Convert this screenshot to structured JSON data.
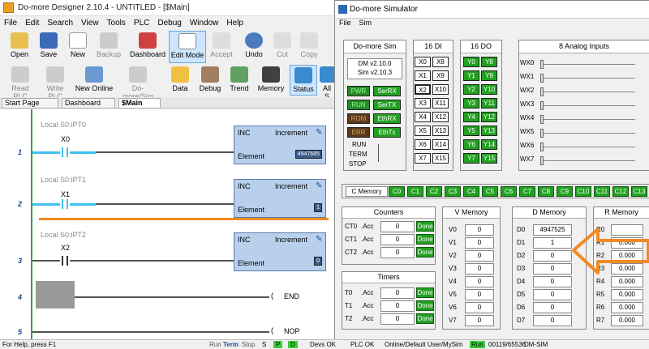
{
  "designer": {
    "title": "Do-more Designer 2.10.4 - UNTITLED - [$Main]",
    "menu": [
      "File",
      "Edit",
      "Search",
      "View",
      "Tools",
      "PLC",
      "Debug",
      "Window",
      "Help"
    ],
    "toolbar1": [
      "Open",
      "Save",
      "New",
      "Backup",
      "Dashboard",
      "Edit Mode",
      "Accept",
      "Undo",
      "Cut",
      "Copy"
    ],
    "toolbar2": [
      "Read PLC",
      "Write PLC",
      "New Online",
      "Do-more/Sim",
      "Data",
      "Debug",
      "Trend",
      "Memory",
      "Status",
      "All S"
    ],
    "tabs": [
      "Start Page",
      "Dashboard",
      "$Main"
    ],
    "rungs": [
      {
        "num": "1",
        "title": "Local S0:iPT0",
        "contact": "X0",
        "instr": "INC",
        "right": "Increment",
        "element": "Element",
        "value": "4947685"
      },
      {
        "num": "2",
        "title": "Local S0:iPT1",
        "contact": "X1",
        "instr": "INC",
        "right": "Increment",
        "element": "Element",
        "value": "1"
      },
      {
        "num": "3",
        "title": "Local S0:iPT2",
        "contact": "X2",
        "instr": "INC",
        "right": "Increment",
        "element": "Element",
        "value": "0"
      },
      {
        "num": "4",
        "coil": "END"
      },
      {
        "num": "5",
        "coil": "NOP"
      }
    ],
    "status": {
      "help": "For Help, press F1",
      "run": "Run",
      "term": "Term",
      "stop": "Stop",
      "s": "S",
      "p": "P",
      "d": "D",
      "devs": "Devs OK",
      "plc": "PLC OK",
      "online": "Online/Default User/MySim",
      "runstate": "Run",
      "mem": "00119/65536",
      "sim": "DM-SIM"
    }
  },
  "simulator": {
    "title": "Do-more Simulator",
    "menu": [
      "File",
      "Sim"
    ],
    "dmsim": {
      "title": "Do-more Sim",
      "ver1": "DM v2.10.0",
      "ver2": "Sim v2.10.3",
      "leds": [
        "PWR",
        "SerRX",
        "RUN",
        "SerTX",
        "ROM",
        "EthRX",
        "ERR",
        "EthTx"
      ],
      "run": "RUN",
      "term": "TERM",
      "stop": "STOP"
    },
    "di": {
      "title": "16 DI",
      "items": [
        "X0",
        "X8",
        "X1",
        "X9",
        "X2",
        "X10",
        "X3",
        "X11",
        "X4",
        "X12",
        "X5",
        "X13",
        "X6",
        "X14",
        "X7",
        "X15"
      ]
    },
    "do": {
      "title": "16 DO",
      "items": [
        "Y0",
        "Y8",
        "Y1",
        "Y9",
        "Y2",
        "Y10",
        "Y3",
        "Y11",
        "Y4",
        "Y12",
        "Y5",
        "Y13",
        "Y6",
        "Y14",
        "Y7",
        "Y15"
      ]
    },
    "analog": {
      "title": "8 Analog Inputs",
      "items": [
        "WX0",
        "WX1",
        "WX2",
        "WX3",
        "WX4",
        "WX5",
        "WX6",
        "WX7"
      ]
    },
    "cmem": {
      "label": "C Memory",
      "items": [
        "C0",
        "C1",
        "C2",
        "C3",
        "C4",
        "C5",
        "C6",
        "C7",
        "C8",
        "C9",
        "C10",
        "C11",
        "C12",
        "C13"
      ]
    },
    "counters": {
      "title": "Counters",
      "rows": [
        {
          "n": "CT0",
          "a": ".Acc",
          "v": "0",
          "d": "Done"
        },
        {
          "n": "CT1",
          "a": ".Acc",
          "v": "0",
          "d": "Done"
        },
        {
          "n": "CT2",
          "a": ".Acc",
          "v": "0",
          "d": "Done"
        }
      ]
    },
    "timers": {
      "title": "Timers",
      "rows": [
        {
          "n": "T0",
          "a": ".Acc",
          "v": "0",
          "d": "Done"
        },
        {
          "n": "T1",
          "a": ".Acc",
          "v": "0",
          "d": "Done"
        },
        {
          "n": "T2",
          "a": ".Acc",
          "v": "0",
          "d": "Done"
        }
      ]
    },
    "vmem": {
      "title": "V Memory",
      "rows": [
        [
          "V0",
          "0"
        ],
        [
          "V1",
          "0"
        ],
        [
          "V2",
          "0"
        ],
        [
          "V3",
          "0"
        ],
        [
          "V4",
          "0"
        ],
        [
          "V5",
          "0"
        ],
        [
          "V6",
          "0"
        ],
        [
          "V7",
          "0"
        ]
      ]
    },
    "dmem": {
      "title": "D Memory",
      "rows": [
        [
          "D0",
          "4947525"
        ],
        [
          "D1",
          "1"
        ],
        [
          "D2",
          "0"
        ],
        [
          "D3",
          "0"
        ],
        [
          "D4",
          "0"
        ],
        [
          "D5",
          "0"
        ],
        [
          "D6",
          "0"
        ],
        [
          "D7",
          "0"
        ]
      ]
    },
    "rmem": {
      "title": "R Memory",
      "rows": [
        [
          "R0",
          ""
        ],
        [
          "R1",
          "0.000"
        ],
        [
          "R2",
          "0.000"
        ],
        [
          "R3",
          "0.000"
        ],
        [
          "R4",
          "0.000"
        ],
        [
          "R5",
          "0.000"
        ],
        [
          "R6",
          "0.000"
        ],
        [
          "R7",
          "0.000"
        ]
      ]
    },
    "arrow_color": "#f08a24"
  }
}
